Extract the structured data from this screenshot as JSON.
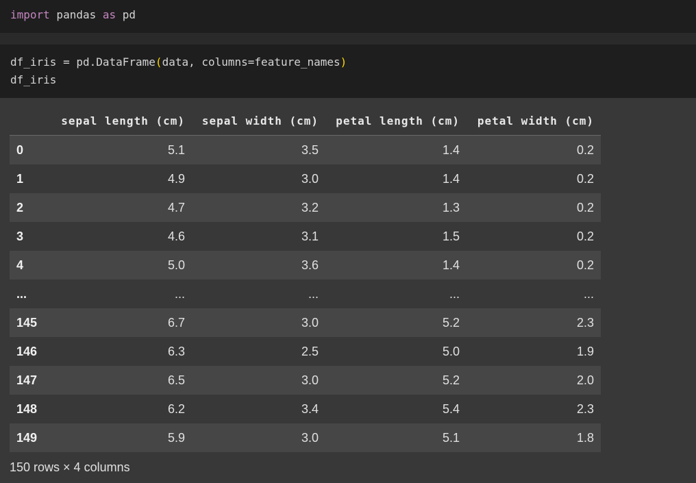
{
  "cells": [
    {
      "lines": [
        [
          "import",
          " pandas ",
          "as",
          " pd"
        ]
      ]
    },
    {
      "lines": [
        [
          "df_iris = pd.DataFrame",
          "(",
          "data, columns=feature_names",
          ")"
        ],
        [
          "df_iris"
        ]
      ]
    }
  ],
  "table": {
    "columns": [
      "sepal length (cm)",
      "sepal width (cm)",
      "petal length (cm)",
      "petal width (cm)"
    ],
    "rows": [
      {
        "index": "0",
        "values": [
          "5.1",
          "3.5",
          "1.4",
          "0.2"
        ]
      },
      {
        "index": "1",
        "values": [
          "4.9",
          "3.0",
          "1.4",
          "0.2"
        ]
      },
      {
        "index": "2",
        "values": [
          "4.7",
          "3.2",
          "1.3",
          "0.2"
        ]
      },
      {
        "index": "3",
        "values": [
          "4.6",
          "3.1",
          "1.5",
          "0.2"
        ]
      },
      {
        "index": "4",
        "values": [
          "5.0",
          "3.6",
          "1.4",
          "0.2"
        ]
      },
      {
        "index": "...",
        "values": [
          "...",
          "...",
          "...",
          "..."
        ]
      },
      {
        "index": "145",
        "values": [
          "6.7",
          "3.0",
          "5.2",
          "2.3"
        ]
      },
      {
        "index": "146",
        "values": [
          "6.3",
          "2.5",
          "5.0",
          "1.9"
        ]
      },
      {
        "index": "147",
        "values": [
          "6.5",
          "3.0",
          "5.2",
          "2.0"
        ]
      },
      {
        "index": "148",
        "values": [
          "6.2",
          "3.4",
          "5.4",
          "2.3"
        ]
      },
      {
        "index": "149",
        "values": [
          "5.9",
          "3.0",
          "5.1",
          "1.8"
        ]
      }
    ]
  },
  "footer": "150 rows × 4 columns",
  "colors": {
    "keyword": "#c586c0",
    "paren": "#ffd700",
    "code_bg": "#1e1e1e",
    "output_bg": "#383838"
  }
}
